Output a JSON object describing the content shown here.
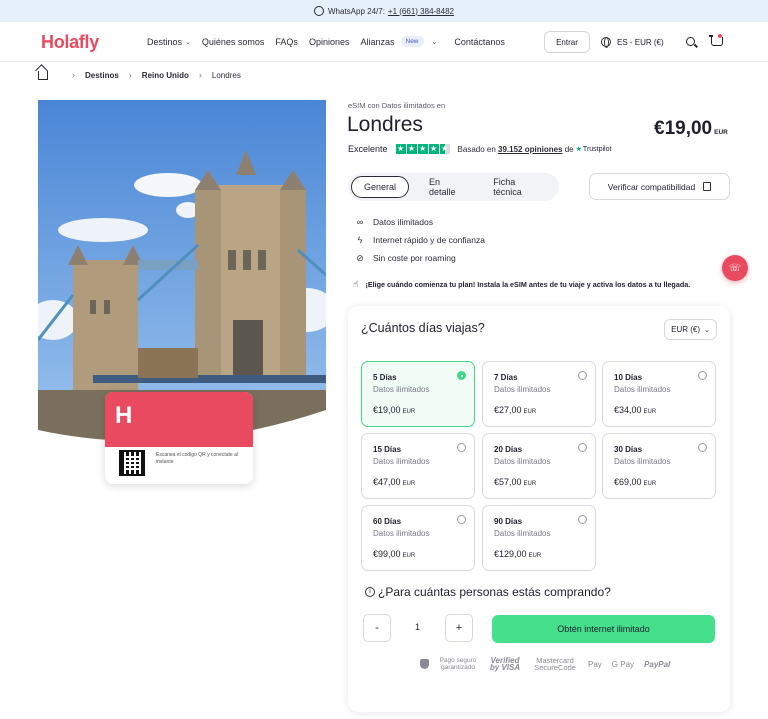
{
  "topbar": {
    "text": "WhatsApp 24/7:",
    "phone": "+1 (661) 384-8482"
  },
  "header": {
    "logo": "Holafly",
    "nav": [
      "Destinos",
      "Quiénes somos",
      "FAQs",
      "Opiniones",
      "Alianzas",
      "Contáctanos"
    ],
    "badge": "New",
    "login": "Entrar",
    "lang": "ES - EUR (€)"
  },
  "breadcrumb": [
    "Destinos",
    "Reino Unido",
    "Londres"
  ],
  "sim": {
    "letter": "H",
    "text": "Escanea el codigo QR y conectate al instante"
  },
  "product": {
    "subtitle": "eSIM con Datos ilimitados en",
    "title": "Londres",
    "price": "€19,00",
    "price_unit": "EUR",
    "rating_label": "Excelente",
    "based": "Basado en",
    "reviews": "39.152 opiniones",
    "de": "de",
    "trustpilot": "Trustpilot",
    "stars": 4.5
  },
  "tabs": [
    "General",
    "En detalle",
    "Ficha técnica"
  ],
  "verify_label": "Verificar compatibilidad",
  "features": [
    "Datos ilimitados",
    "Internet rápido y de confianza",
    "Sin coste por roaming"
  ],
  "note": "¡Elige cuándo comienza tu plan! Instala la eSIM antes de tu viaje y activa los datos a tu llegada.",
  "plan": {
    "question": "¿Cuántos días viajas?",
    "currency": "EUR (€)",
    "options": [
      {
        "days": "5 Días",
        "data": "Datos ilimitados",
        "price": "€19,00",
        "unit": "EUR",
        "selected": true
      },
      {
        "days": "7 Días",
        "data": "Datos ilimitados",
        "price": "€27,00",
        "unit": "EUR",
        "selected": false
      },
      {
        "days": "10 Días",
        "data": "Datos ilimitados",
        "price": "€34,00",
        "unit": "EUR",
        "selected": false
      },
      {
        "days": "15 Días",
        "data": "Datos ilimitados",
        "price": "€47,00",
        "unit": "EUR",
        "selected": false
      },
      {
        "days": "20 Días",
        "data": "Datos ilimitados",
        "price": "€57,00",
        "unit": "EUR",
        "selected": false
      },
      {
        "days": "30 Días",
        "data": "Datos ilimitados",
        "price": "€69,00",
        "unit": "EUR",
        "selected": false
      },
      {
        "days": "60 Días",
        "data": "Datos ilimitados",
        "price": "€99,00",
        "unit": "EUR",
        "selected": false
      },
      {
        "days": "90 Días",
        "data": "Datos ilimitados",
        "price": "€129,00",
        "unit": "EUR",
        "selected": false
      }
    ],
    "persons_question": "¿Para cuántas personas estás comprando?",
    "minus": "-",
    "plus": "+",
    "quantity": "1",
    "cta": "Obtén internet ilimitado",
    "payments": {
      "secure": "Pago seguro garantizado",
      "visa": "Verified by VISA",
      "mastercard": "Mastercard SecureCode",
      "applepay": "Pay",
      "gpay": "G Pay",
      "paypal": "PayPal"
    }
  },
  "colors": {
    "brand": "#e94a5f",
    "accent": "#44e08c",
    "trustpilot": "#00b67a"
  }
}
